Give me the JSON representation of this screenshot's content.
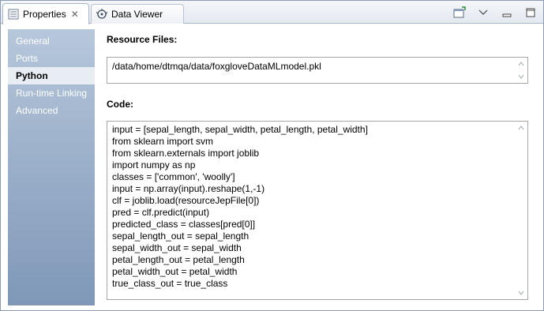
{
  "tabs": [
    {
      "label": "Properties",
      "icon": "properties-icon",
      "active": true
    },
    {
      "label": "Data Viewer",
      "icon": "data-viewer-icon",
      "active": false
    }
  ],
  "toolbar": {
    "icons": [
      "new-view-icon",
      "view-menu-icon",
      "minimize-icon",
      "maximize-icon"
    ]
  },
  "sidebar": {
    "items": [
      {
        "label": "General",
        "selected": false
      },
      {
        "label": "Ports",
        "selected": false
      },
      {
        "label": "Python",
        "selected": true
      },
      {
        "label": "Run-time Linking",
        "selected": false
      },
      {
        "label": "Advanced",
        "selected": false
      }
    ]
  },
  "resource_files": {
    "label": "Resource Files:",
    "value": "/data/home/dtmqa/data/foxgloveDataMLmodel.pkl"
  },
  "code": {
    "label": "Code:",
    "lines": [
      "input = [sepal_length, sepal_width, petal_length, petal_width]",
      "from sklearn import svm",
      "from sklearn.externals import joblib",
      "import numpy as np",
      "classes = ['common', 'woolly']",
      "input = np.array(input).reshape(1,-1)",
      "clf = joblib.load(resourceJepFile[0])",
      "pred = clf.predict(input)",
      "predicted_class = classes[pred[0]]",
      "sepal_length_out = sepal_length",
      "sepal_width_out = sepal_width",
      "petal_length_out = petal_length",
      "petal_width_out = petal_width",
      "true_class_out = true_class"
    ]
  },
  "colors": {
    "sidebar_top": "#b7c8dc",
    "sidebar_bottom": "#7f98b8",
    "selected_item_bg": "#e8edf4"
  }
}
